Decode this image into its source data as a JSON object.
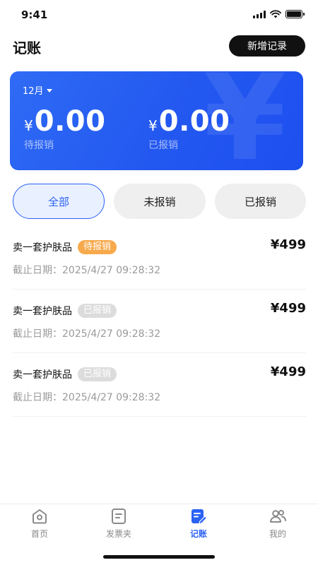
{
  "status_bar": {
    "time": "9:41",
    "battery_level": 1.0
  },
  "header": {
    "title": "记账",
    "add_button": "新增记录"
  },
  "summary": {
    "month": "12月",
    "watermark": "¥",
    "pending": {
      "symbol": "¥",
      "amount": "0.00",
      "label": "待报销"
    },
    "claimed": {
      "symbol": "¥",
      "amount": "0.00",
      "label": "已报销"
    }
  },
  "filters": {
    "all": "全部",
    "unclaimed": "未报销",
    "claimed": "已报销",
    "selected": "全部"
  },
  "records": [
    {
      "title": "卖一套护肤品",
      "status": "待报销",
      "amount": "¥499",
      "date": "截止日期：2025/4/27 09:28:32"
    },
    {
      "title": "卖一套护肤品",
      "status": "已报销",
      "amount": "¥499",
      "date": "截止日期：2025/4/27 09:28:32"
    },
    {
      "title": "卖一套护肤品",
      "status": "已报销",
      "amount": "¥499",
      "date": "截止日期：2025/4/27 09:28:32"
    }
  ],
  "nav": {
    "home": {
      "label": "首页",
      "icon": "home-icon"
    },
    "invoices": {
      "label": "发票夹",
      "icon": "invoice-folder-icon"
    },
    "accounting": {
      "label": "记账",
      "icon": "accounting-pencil-icon"
    },
    "mine": {
      "label": "我的",
      "icon": "people-icon"
    },
    "active": "记账"
  },
  "colors": {
    "accent": "#2b62f4",
    "pending_badge": "#f7a94c",
    "done_badge": "#dcdcdc",
    "button_dark": "#111111"
  }
}
